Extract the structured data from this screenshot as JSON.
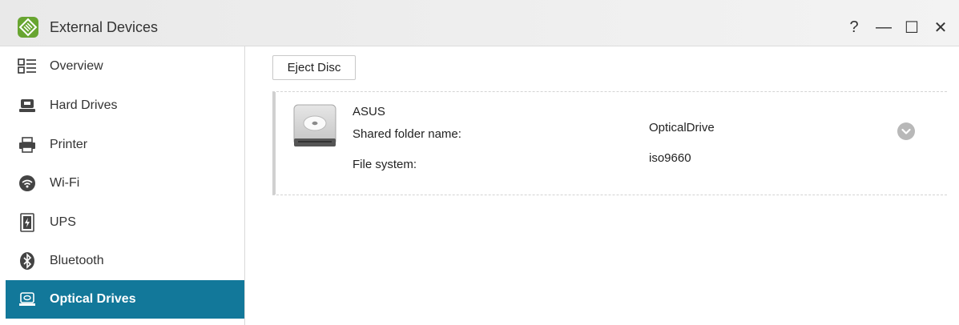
{
  "window": {
    "title": "External Devices",
    "controls": {
      "help": "?",
      "minimize": "—",
      "maximize": "☐",
      "close": "✕"
    },
    "accent": "#12789a"
  },
  "sidebar": {
    "items": [
      {
        "label": "Overview",
        "icon": "overview-icon"
      },
      {
        "label": "Hard Drives",
        "icon": "hard-drive-icon"
      },
      {
        "label": "Printer",
        "icon": "printer-icon"
      },
      {
        "label": "Wi-Fi",
        "icon": "wifi-icon"
      },
      {
        "label": "UPS",
        "icon": "ups-icon"
      },
      {
        "label": "Bluetooth",
        "icon": "bluetooth-icon"
      },
      {
        "label": "Optical Drives",
        "icon": "optical-drive-icon",
        "active": true
      }
    ]
  },
  "toolbar": {
    "eject_label": "Eject Disc"
  },
  "device": {
    "name": "ASUS",
    "icon": "optical-disc-drive-icon",
    "fields": [
      {
        "label": "Shared folder name:",
        "value": "OpticalDrive"
      },
      {
        "label": "File system:",
        "value": "iso9660"
      }
    ]
  }
}
